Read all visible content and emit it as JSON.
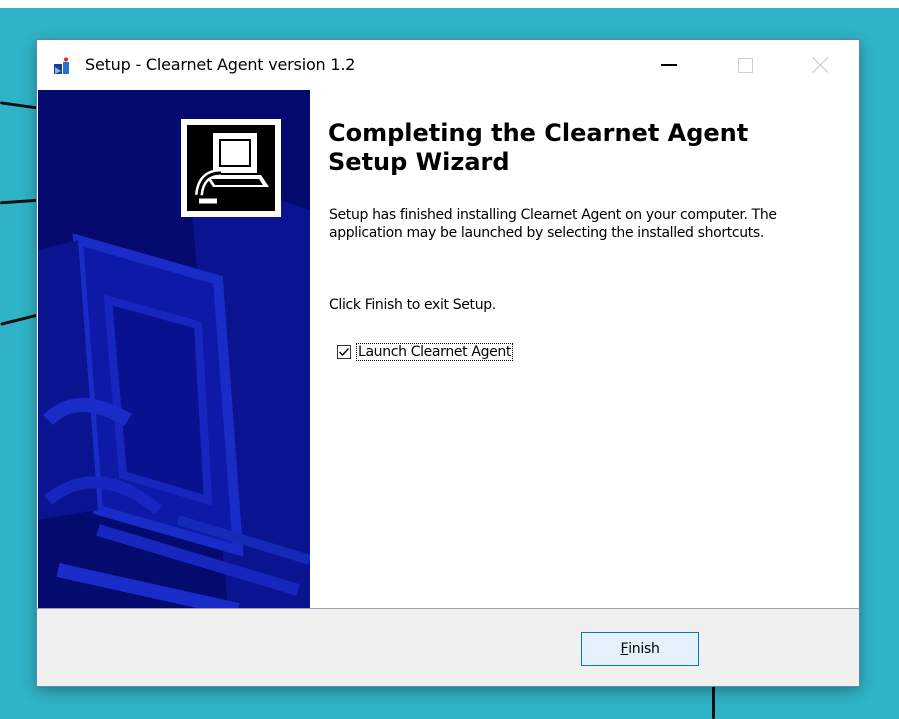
{
  "window": {
    "title": "Setup - Clearnet Agent version 1.2",
    "controls": {
      "minimize": "minimize",
      "maximize": "maximize",
      "close": "close"
    }
  },
  "wizard": {
    "heading": "Completing the Clearnet Agent Setup Wizard",
    "message": "Setup has finished installing Clearnet Agent on your computer. The application may be launched by selecting the installed shortcuts.",
    "instruction": "Click Finish to exit Setup.",
    "launch_option": {
      "label": "Launch Clearnet Agent",
      "checked": true
    }
  },
  "buttons": {
    "finish": {
      "accel": "F",
      "rest": "inish"
    }
  },
  "colors": {
    "desktop": "#2fb3c6",
    "side_panel": "#050a6e",
    "button_border": "#0078d7",
    "button_bg": "#e5f1fb"
  },
  "icons": {
    "app": "installer-icon",
    "side": "computer-install-icon",
    "check": "checkmark-icon"
  }
}
